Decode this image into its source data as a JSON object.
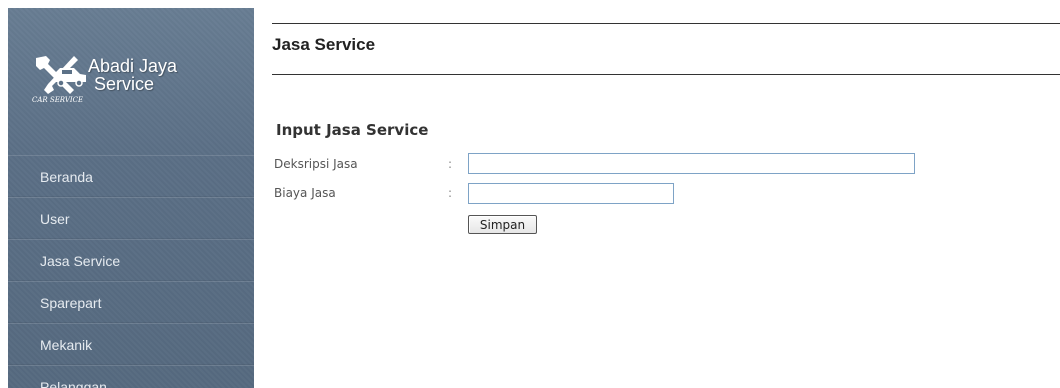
{
  "brand": {
    "name_line1": "Abadi Jaya",
    "name_line2": "Service",
    "tagline": "CAR SERVICE",
    "icon": "wrench-car-icon"
  },
  "sidebar": {
    "items": [
      {
        "label": "Beranda"
      },
      {
        "label": "User"
      },
      {
        "label": "Jasa Service"
      },
      {
        "label": "Sparepart"
      },
      {
        "label": "Mekanik"
      },
      {
        "label": "Pelanggan"
      }
    ]
  },
  "header": {
    "title": "Jasa Service"
  },
  "form": {
    "heading": "Input Jasa Service",
    "fields": [
      {
        "label": "Deksripsi Jasa",
        "separator": ":",
        "value": ""
      },
      {
        "label": "Biaya Jasa",
        "separator": ":",
        "value": ""
      }
    ],
    "submit_label": "Simpan"
  },
  "colors": {
    "sidebar_bg": "#5c7187",
    "input_border": "#7ea3c6",
    "nav_text": "#e6ebf0"
  }
}
